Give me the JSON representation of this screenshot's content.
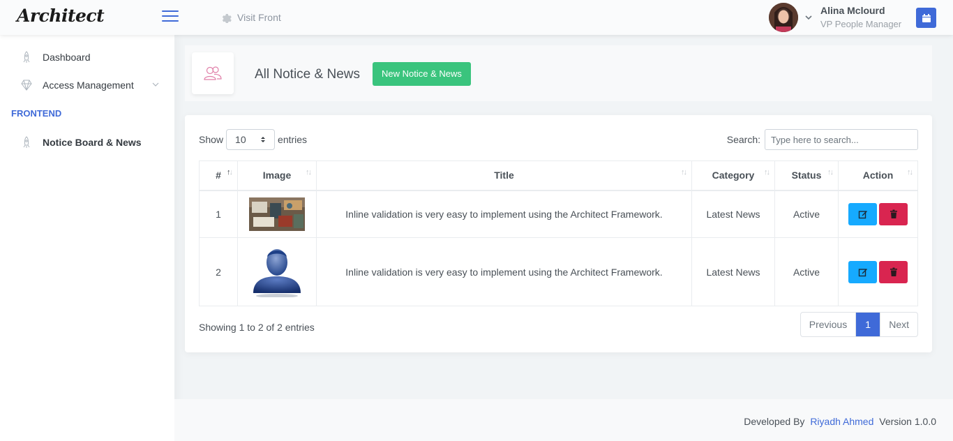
{
  "app": {
    "logo": "Architect",
    "visit_front": "Visit Front"
  },
  "user": {
    "name": "Alina Mclourd",
    "role": "VP People Manager"
  },
  "sidebar": {
    "items": [
      {
        "label": "Dashboard",
        "icon": "rocket-icon"
      },
      {
        "label": "Access Management",
        "icon": "diamond-icon"
      }
    ],
    "section_heading": "FRONTEND",
    "section_items": [
      {
        "label": "Notice Board & News",
        "icon": "rocket-icon"
      }
    ]
  },
  "page": {
    "title": "All Notice & News",
    "new_button": "New Notice & News"
  },
  "table_controls": {
    "show_label": "Show",
    "entries_value": "10",
    "entries_label": "entries",
    "search_label": "Search:",
    "search_placeholder": "Type here to search..."
  },
  "table": {
    "columns": [
      "#",
      "Image",
      "Title",
      "Category",
      "Status",
      "Action"
    ],
    "rows": [
      {
        "num": "1",
        "image": "desk-photo",
        "title": "Inline validation is very easy to implement using the Architect Framework.",
        "category": "Latest News",
        "status": "Active"
      },
      {
        "num": "2",
        "image": "default-user-avatar",
        "title": "Inline validation is very easy to implement using the Architect Framework.",
        "category": "Latest News",
        "status": "Active"
      }
    ]
  },
  "pagination": {
    "info": "Showing 1 to 2 of 2 entries",
    "previous": "Previous",
    "current": "1",
    "next": "Next"
  },
  "footer": {
    "developed_by": "Developed By",
    "author": "Riyadh Ahmed",
    "version": "Version 1.0.0"
  },
  "colors": {
    "primary": "#3f6ad8",
    "success": "#3ac47d",
    "info": "#16aaff",
    "danger": "#d92550"
  }
}
